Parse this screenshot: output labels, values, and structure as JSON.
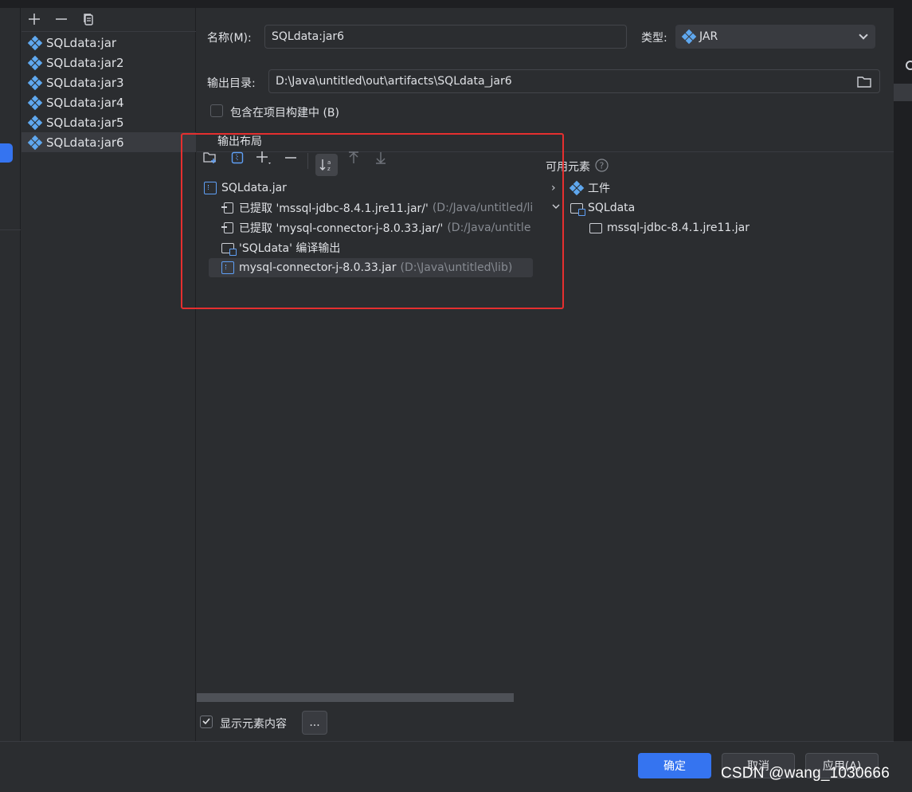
{
  "window": {
    "left_toolbar": {
      "add": "+",
      "remove": "—",
      "copy": "copy"
    },
    "artifacts": [
      {
        "label": "SQLdata:jar",
        "selected": false
      },
      {
        "label": "SQLdata:jar2",
        "selected": false
      },
      {
        "label": "SQLdata:jar3",
        "selected": false
      },
      {
        "label": "SQLdata:jar4",
        "selected": false
      },
      {
        "label": "SQLdata:jar5",
        "selected": false
      },
      {
        "label": "SQLdata:jar6",
        "selected": true
      }
    ]
  },
  "form": {
    "name_label": "名称(M):",
    "name_value": "SQLdata:jar6",
    "type_label": "类型:",
    "type_value": "JAR",
    "output_dir_label": "输出目录:",
    "output_dir_value": "D:\\Java\\untitled\\out\\artifacts\\SQLdata_jar6",
    "include_in_build_label": "包含在项目构建中 (B)",
    "include_in_build_checked": false,
    "output_layout_label": "输出布局"
  },
  "layout_tree": [
    {
      "icon": "jar-file-icon",
      "text": "SQLdata.jar",
      "muted": ""
    },
    {
      "icon": "extracted-icon",
      "text": "已提取 'mssql-jdbc-8.4.1.jre11.jar/'",
      "muted": "(D:/Java/untitled/li"
    },
    {
      "icon": "extracted-icon",
      "text": "已提取 'mysql-connector-j-8.0.33.jar/'",
      "muted": "(D:/Java/untitle"
    },
    {
      "icon": "module-folder-icon",
      "text": "'SQLdata' 编译输出",
      "muted": ""
    },
    {
      "icon": "jar-file-icon",
      "text": "mysql-connector-j-8.0.33.jar",
      "muted": "(D:\\Java\\untitled\\lib)"
    }
  ],
  "available": {
    "label": "可用元素",
    "items": [
      {
        "icon": "artifact-icon",
        "text": "工件",
        "expanded": false
      },
      {
        "icon": "module-folder-icon",
        "text": "SQLdata",
        "expanded": true
      },
      {
        "icon": "folder-icon",
        "text": "mssql-jdbc-8.4.1.jre11.jar",
        "expanded": false
      }
    ]
  },
  "show_content_label": "显示元素内容",
  "show_content_checked": true,
  "more_button": "...",
  "buttons": {
    "ok": "确定",
    "cancel": "取消",
    "apply": "应用(A)"
  },
  "watermark": "CSDN @wang_1030666",
  "colors": {
    "accent": "#3574f0",
    "highlight_box": "#e52f2f",
    "background": "#2b2d30"
  }
}
